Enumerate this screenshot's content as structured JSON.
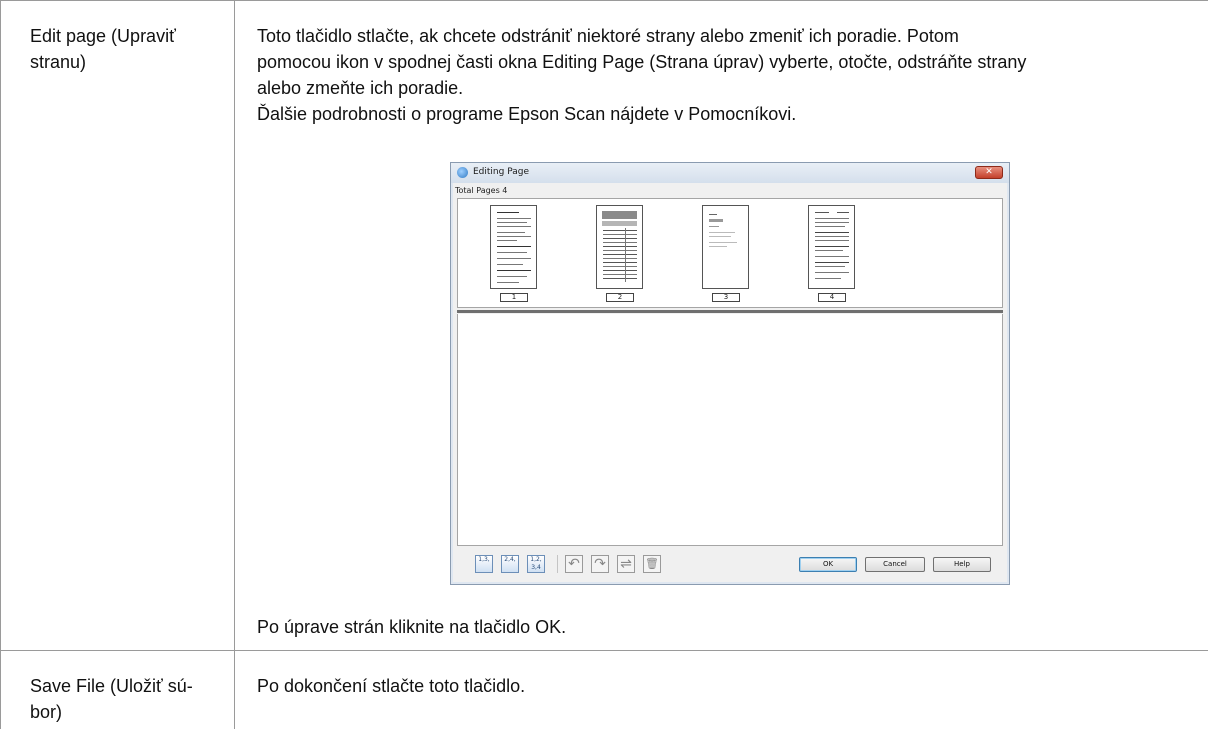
{
  "rows": [
    {
      "term_lines": [
        "Edit page (Upraviť",
        "stranu)"
      ],
      "description_lines": [
        "Toto tlačidlo stlačte, ak chcete odstrániť niektoré strany alebo zmeniť ich poradie. Potom",
        "pomocou ikon v spodnej časti okna Editing Page (Strana úprav) vyberte, otočte, odstráňte strany",
        "alebo zmeňte ich poradie.",
        "Ďalšie podrobnosti o programe Epson Scan nájdete v Pomocníkovi."
      ],
      "after_text": "Po úprave strán kliknite na tlačidlo OK."
    },
    {
      "term_lines": [
        "Save File (Uložiť sú-",
        "bor)"
      ],
      "description_lines": [
        "Po dokončení stlačte toto tlačidlo."
      ]
    }
  ],
  "screenshot": {
    "window_title": "Editing Page",
    "close_glyph": "✕",
    "total_pages_label": "Total Pages 4",
    "page_numbers": [
      "1",
      "2",
      "3",
      "4"
    ],
    "toolbar": {
      "icons": [
        "odd-pages-icon",
        "even-pages-icon",
        "all-pages-icon",
        "rotate-left-icon",
        "rotate-right-icon",
        "reorder-icon",
        "delete-icon"
      ],
      "odd_label": "1,3,",
      "even_label": "2,4,",
      "all_label": "1,2, 3,4",
      "rotate_left_glyph": "↶",
      "rotate_right_glyph": "↷",
      "reorder_glyph": "⇌",
      "delete_glyph": "🗑"
    },
    "buttons": {
      "ok": "OK",
      "cancel": "Cancel",
      "help": "Help"
    }
  }
}
